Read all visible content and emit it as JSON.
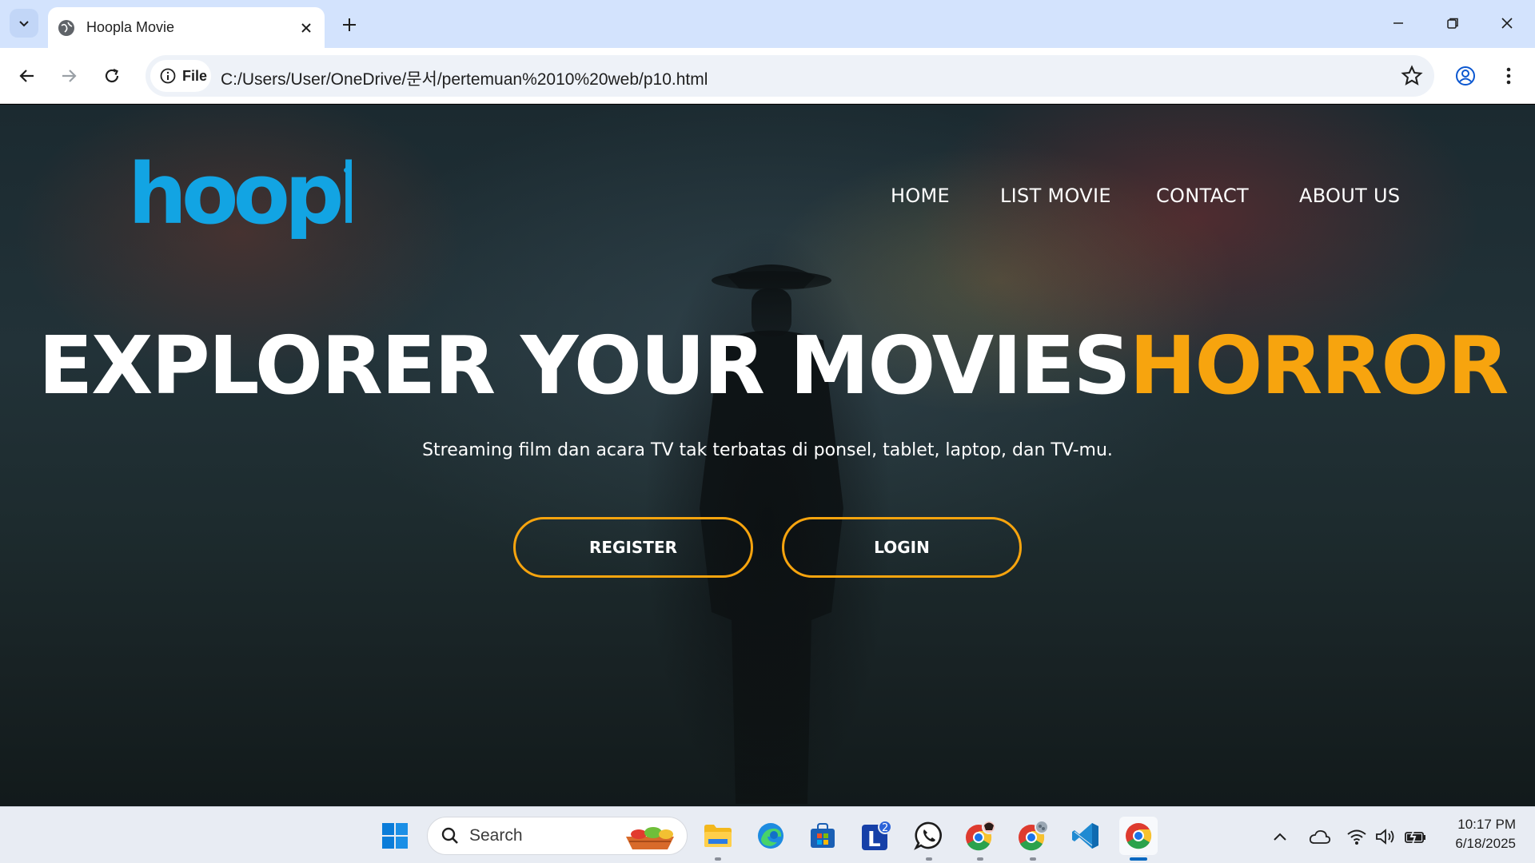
{
  "browser": {
    "tab_title": "Hoopla Movie",
    "url_chip": "File",
    "url": "C:/Users/User/OneDrive/문서/pertemuan%2010%20web/p10.html"
  },
  "site": {
    "logo_text": "hoopla",
    "nav": [
      "HOME",
      "LIST MOVIE",
      "CONTACT",
      "ABOUT US"
    ],
    "headline_white": "EXPLORER YOUR MOVIES",
    "headline_accent": "HORROR",
    "tagline": "Streaming film dan acara TV tak terbatas di ponsel, tablet, laptop, dan TV-mu.",
    "register_label": "REGISTER",
    "login_label": "LOGIN",
    "colors": {
      "accent": "#f7a40e",
      "logo": "#12a4e3"
    }
  },
  "taskbar": {
    "search_placeholder": "Search",
    "time": "10:17 PM",
    "date": "6/18/2025",
    "badge_count": "2",
    "icons": [
      "windows-start-icon",
      "file-explorer-icon",
      "edge-icon",
      "microsoft-store-icon",
      "l-app-icon",
      "whatsapp-icon",
      "chrome-profile-1-icon",
      "chrome-profile-2-icon",
      "vscode-icon",
      "chrome-icon"
    ]
  }
}
